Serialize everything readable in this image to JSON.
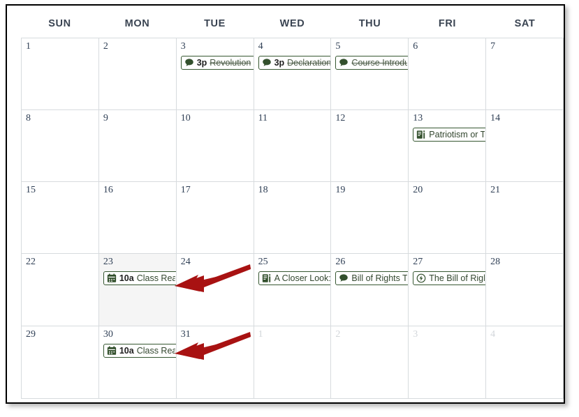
{
  "calendar": {
    "weekdays": [
      "SUN",
      "MON",
      "TUE",
      "WED",
      "THU",
      "FRI",
      "SAT"
    ],
    "accent_color": "#365731",
    "today_bg": "#f5f5f5",
    "annotation_color": "#a81212",
    "weeks": [
      {
        "days": [
          {
            "num": "1",
            "other": false,
            "today": false,
            "events": []
          },
          {
            "num": "2",
            "other": false,
            "today": false,
            "events": []
          },
          {
            "num": "3",
            "other": false,
            "today": false,
            "events": [
              {
                "icon": "discussion-icon",
                "time": "3p",
                "title": "Revolution",
                "strike": true
              }
            ]
          },
          {
            "num": "4",
            "other": false,
            "today": false,
            "events": [
              {
                "icon": "discussion-icon",
                "time": "3p",
                "title": "Declaration",
                "strike": true
              }
            ]
          },
          {
            "num": "5",
            "other": false,
            "today": false,
            "events": [
              {
                "icon": "discussion-icon",
                "time": "",
                "title": "Course Introdu",
                "strike": true
              }
            ]
          },
          {
            "num": "6",
            "other": false,
            "today": false,
            "events": []
          },
          {
            "num": "7",
            "other": false,
            "today": false,
            "events": []
          }
        ]
      },
      {
        "days": [
          {
            "num": "8",
            "other": false,
            "today": false,
            "events": []
          },
          {
            "num": "9",
            "other": false,
            "today": false,
            "events": []
          },
          {
            "num": "10",
            "other": false,
            "today": false,
            "events": []
          },
          {
            "num": "11",
            "other": false,
            "today": false,
            "events": []
          },
          {
            "num": "12",
            "other": false,
            "today": false,
            "events": []
          },
          {
            "num": "13",
            "other": false,
            "today": false,
            "events": [
              {
                "icon": "assignment-icon",
                "time": "",
                "title": "Patriotism or T",
                "strike": false
              }
            ]
          },
          {
            "num": "14",
            "other": false,
            "today": false,
            "events": []
          }
        ]
      },
      {
        "days": [
          {
            "num": "15",
            "other": false,
            "today": false,
            "events": []
          },
          {
            "num": "16",
            "other": false,
            "today": false,
            "events": []
          },
          {
            "num": "17",
            "other": false,
            "today": false,
            "events": []
          },
          {
            "num": "18",
            "other": false,
            "today": false,
            "events": []
          },
          {
            "num": "19",
            "other": false,
            "today": false,
            "events": []
          },
          {
            "num": "20",
            "other": false,
            "today": false,
            "events": []
          },
          {
            "num": "21",
            "other": false,
            "today": false,
            "events": []
          }
        ]
      },
      {
        "days": [
          {
            "num": "22",
            "other": false,
            "today": false,
            "events": []
          },
          {
            "num": "23",
            "other": false,
            "today": true,
            "events": [
              {
                "icon": "calendar-event-icon",
                "time": "10a",
                "title": "Class Read",
                "strike": false
              }
            ]
          },
          {
            "num": "24",
            "other": false,
            "today": false,
            "events": []
          },
          {
            "num": "25",
            "other": false,
            "today": false,
            "events": [
              {
                "icon": "assignment-icon",
                "time": "",
                "title": "A Closer Look:",
                "strike": false
              }
            ]
          },
          {
            "num": "26",
            "other": false,
            "today": false,
            "events": [
              {
                "icon": "discussion-icon",
                "time": "",
                "title": "Bill of Rights To",
                "strike": false
              }
            ]
          },
          {
            "num": "27",
            "other": false,
            "today": false,
            "events": [
              {
                "icon": "quiz-icon",
                "time": "",
                "title": "The Bill of Righ",
                "strike": false
              }
            ]
          },
          {
            "num": "28",
            "other": false,
            "today": false,
            "events": []
          }
        ]
      },
      {
        "days": [
          {
            "num": "29",
            "other": false,
            "today": false,
            "events": []
          },
          {
            "num": "30",
            "other": false,
            "today": false,
            "events": [
              {
                "icon": "calendar-event-icon",
                "time": "10a",
                "title": "Class Read",
                "strike": false
              }
            ]
          },
          {
            "num": "31",
            "other": false,
            "today": false,
            "events": []
          },
          {
            "num": "1",
            "other": true,
            "today": false,
            "events": []
          },
          {
            "num": "2",
            "other": true,
            "today": false,
            "events": []
          },
          {
            "num": "3",
            "other": true,
            "today": false,
            "events": []
          },
          {
            "num": "4",
            "other": true,
            "today": false,
            "events": []
          }
        ]
      }
    ],
    "annotations": [
      {
        "name": "arrow-to-day-23-event",
        "points_to": "10a Class Read on day 23"
      },
      {
        "name": "arrow-to-day-30-event",
        "points_to": "10a Class Read on day 30"
      }
    ]
  }
}
